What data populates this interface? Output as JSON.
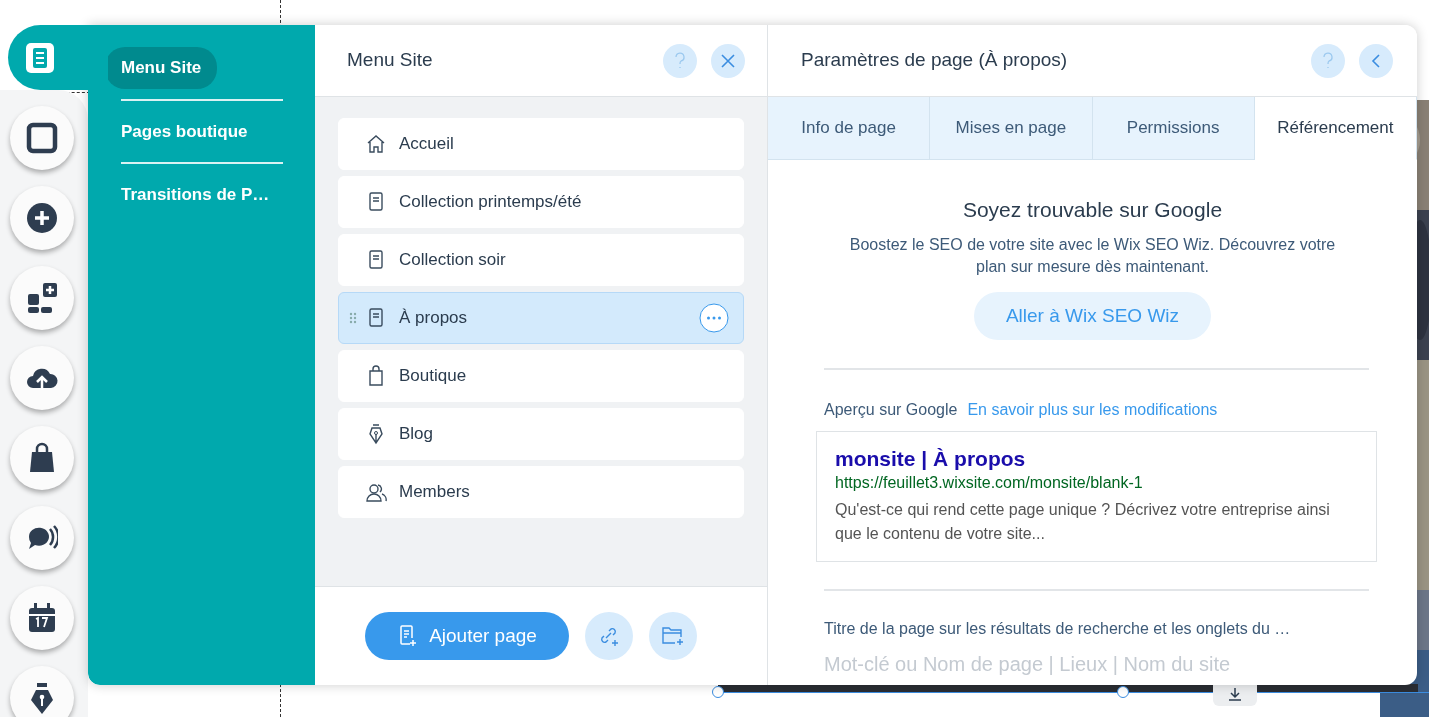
{
  "tool_rail": [
    {
      "kind": "pages",
      "selected": true
    },
    {
      "kind": "background",
      "selected": false
    },
    {
      "kind": "add",
      "selected": false
    },
    {
      "kind": "apps",
      "selected": false
    },
    {
      "kind": "upload",
      "selected": false
    },
    {
      "kind": "store",
      "selected": false
    },
    {
      "kind": "chat",
      "selected": false
    },
    {
      "kind": "calendar",
      "selected": false
    },
    {
      "kind": "blog",
      "selected": false
    }
  ],
  "menu_sections": [
    {
      "label": "Menu Site",
      "selected": true
    },
    {
      "label": "Pages boutique",
      "selected": false
    },
    {
      "label": "Transitions de P…",
      "selected": false
    }
  ],
  "site_menu": {
    "title": "Menu Site",
    "pages": [
      {
        "label": "Accueil",
        "kind": "home",
        "selected": false
      },
      {
        "label": "Collection printemps/été",
        "kind": "page",
        "selected": false
      },
      {
        "label": "Collection soir",
        "kind": "page",
        "selected": false
      },
      {
        "label": "À propos",
        "kind": "page",
        "selected": true
      },
      {
        "label": "Boutique",
        "kind": "bag",
        "selected": false
      },
      {
        "label": "Blog",
        "kind": "pen",
        "selected": false
      },
      {
        "label": "Members",
        "kind": "members",
        "selected": false
      }
    ],
    "add_button": "Ajouter page"
  },
  "page_settings": {
    "title": "Paramètres de page (À propos)",
    "tabs": [
      {
        "label": "Info de page",
        "selected": false
      },
      {
        "label": "Mises en page",
        "selected": false
      },
      {
        "label": "Permissions",
        "selected": false
      },
      {
        "label": "Référencement",
        "selected": true
      }
    ],
    "seo": {
      "heading": "Soyez trouvable sur Google",
      "text": "Boostez le SEO de votre site avec le Wix SEO Wiz. Découvrez votre plan sur mesure dès maintenant.",
      "button": "Aller à Wix SEO Wiz"
    },
    "preview": {
      "label": "Aperçu sur Google",
      "link": "En savoir plus sur les modifications",
      "title": "monsite | À propos",
      "url": "https://feuillet3.wixsite.com/monsite/blank-1",
      "description": "Qu'est-ce qui rend cette page unique ? Décrivez votre entreprise ainsi que le contenu de votre site..."
    },
    "title_field": {
      "label": "Titre de la page sur les résultats de recherche et les onglets du …",
      "placeholder": "Mot-clé ou Nom de page | Lieux | Nom du site"
    }
  }
}
